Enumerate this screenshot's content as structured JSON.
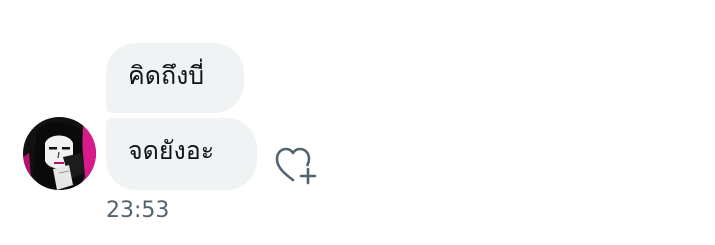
{
  "conversation": {
    "messages": [
      {
        "text": "คิดถึงบี่"
      },
      {
        "text": "จดยังอะ"
      }
    ],
    "timestamp": "23:53",
    "avatar_icon": "user-avatar-photo",
    "reaction_icon": "heart-plus-icon",
    "colors": {
      "bubble_bg": "#eff3f4",
      "text": "#0f1419",
      "timestamp": "#536471",
      "icon": "#536471"
    }
  }
}
